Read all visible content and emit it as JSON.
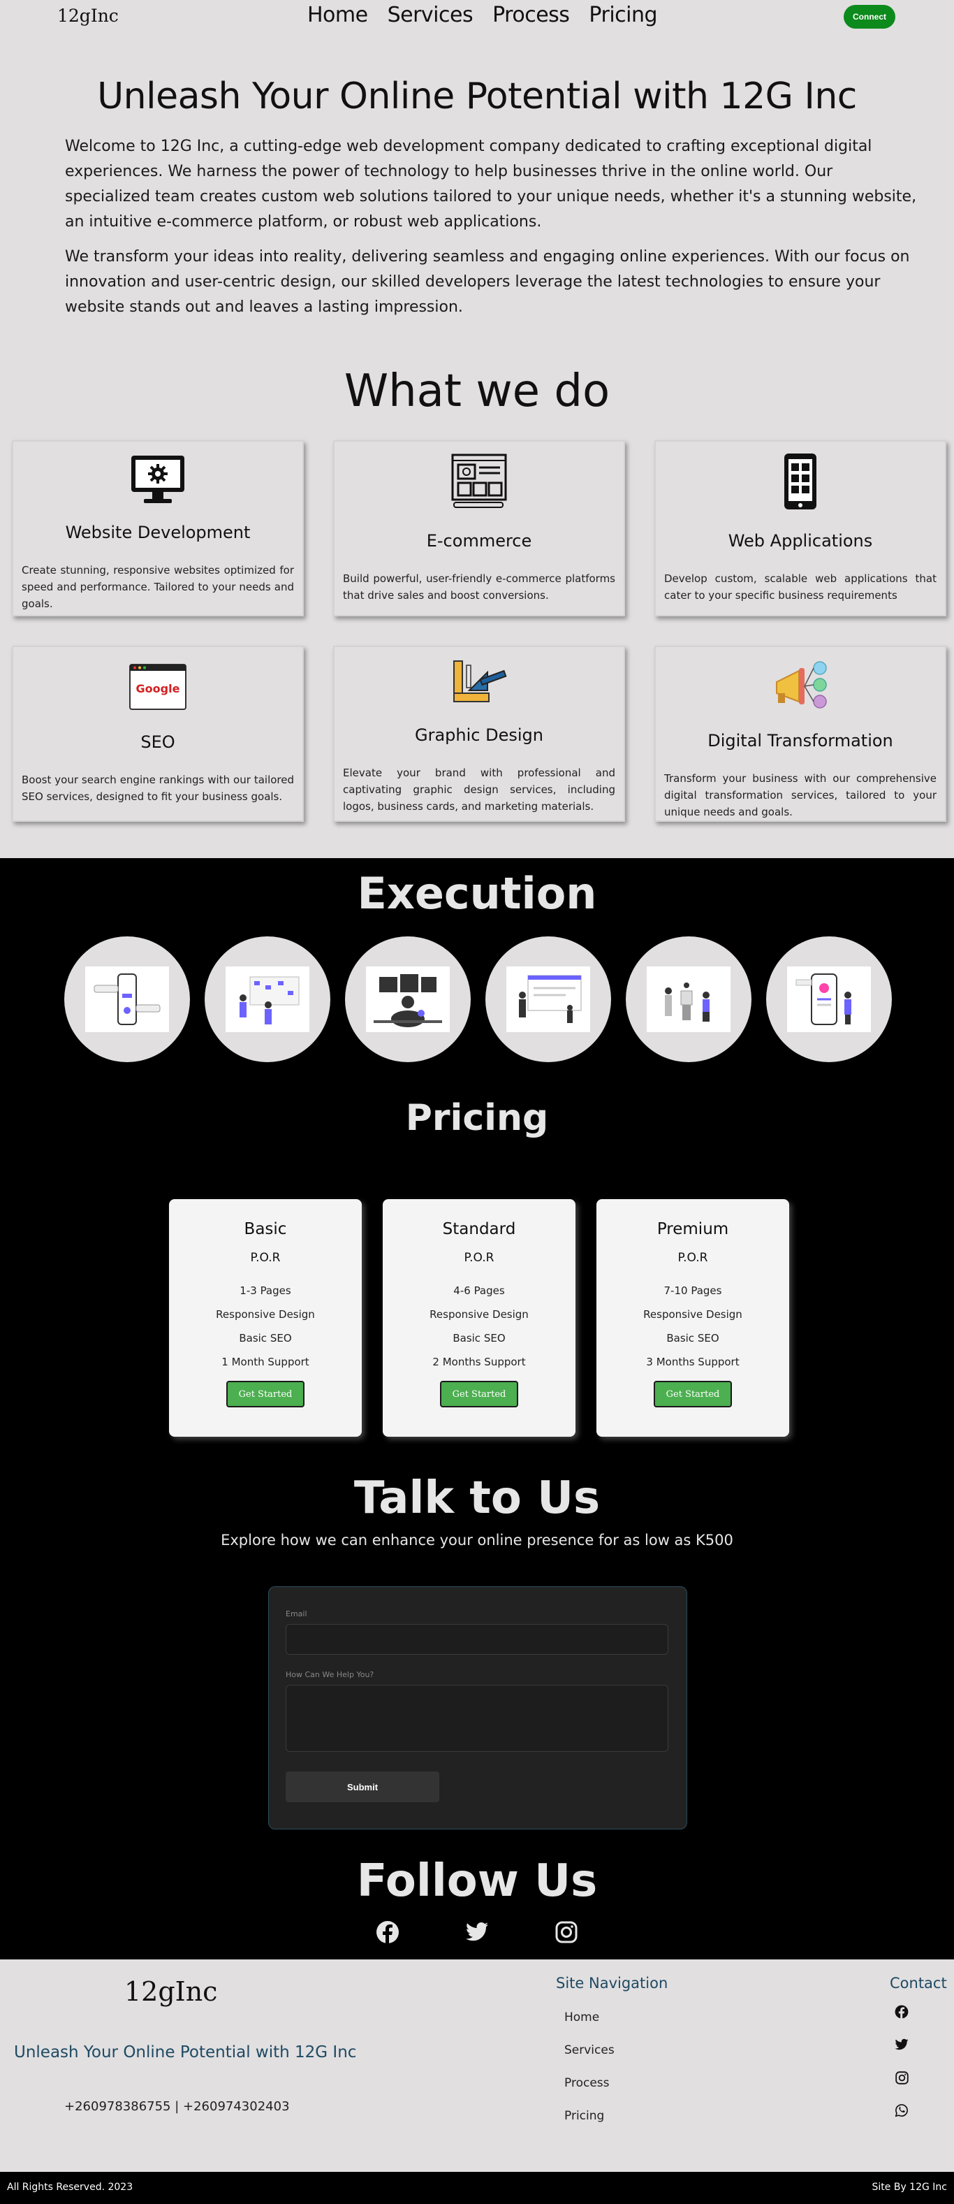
{
  "header": {
    "logo": "12gInc",
    "nav": [
      "Home",
      "Services",
      "Process",
      "Pricing"
    ],
    "connect_label": "Connect"
  },
  "hero": {
    "title": "Unleash Your Online Potential with 12G Inc",
    "paragraphs": [
      "Welcome to 12G Inc, a cutting-edge web development company dedicated to crafting exceptional digital experiences. We harness the power of technology to help businesses thrive in the online world. Our specialized team creates custom web solutions tailored to your unique needs, whether it's a stunning website, an intuitive e-commerce platform, or robust web applications.",
      "We transform your ideas into reality, delivering seamless and engaging online experiences. With our focus on innovation and user-centric design, our skilled developers leverage the latest technologies to ensure your website stands out and leaves a lasting impression."
    ]
  },
  "services": {
    "title": "What we do",
    "items": [
      {
        "icon": "monitor-gear-icon",
        "title": "Website Development",
        "text": "Create stunning, responsive websites optimized for speed and performance. Tailored to your needs and goals."
      },
      {
        "icon": "wireframe-icon",
        "title": "E-commerce",
        "text": "Build powerful, user-friendly e-commerce platforms that drive sales and boost conversions."
      },
      {
        "icon": "mobile-app-icon",
        "title": "Web Applications",
        "text": "Develop custom, scalable web applications that cater to your specific business requirements"
      },
      {
        "icon": "google-search-icon",
        "title": "SEO",
        "text": "Boost your search engine rankings with our tailored SEO services, designed to fit your business goals.",
        "icon_text": "Google"
      },
      {
        "icon": "design-tools-icon",
        "title": "Graphic Design",
        "text": "Elevate your brand with professional and captivating graphic design services, including logos, business cards, and marketing materials."
      },
      {
        "icon": "megaphone-icon",
        "title": "Digital Transformation",
        "text": "Transform your business with our comprehensive digital transformation services, tailored to your unique needs and goals."
      }
    ]
  },
  "execution": {
    "title": "Execution",
    "images": [
      "mobile-chat-illustration",
      "team-board-illustration",
      "developer-desk-illustration",
      "presentation-illustration",
      "collaboration-illustration",
      "mobile-profile-illustration"
    ]
  },
  "pricing": {
    "title": "Pricing",
    "plans": [
      {
        "name": "Basic",
        "price": "P.O.R",
        "features": [
          "1-3 Pages",
          "Responsive Design",
          "Basic SEO",
          "1 Month Support"
        ],
        "cta": "Get Started"
      },
      {
        "name": "Standard",
        "price": "P.O.R",
        "features": [
          "4-6 Pages",
          "Responsive Design",
          "Basic SEO",
          "2 Months Support"
        ],
        "cta": "Get Started"
      },
      {
        "name": "Premium",
        "price": "P.O.R",
        "features": [
          "7-10 Pages",
          "Responsive Design",
          "Basic SEO",
          "3 Months Support"
        ],
        "cta": "Get Started"
      }
    ]
  },
  "contact_form": {
    "title": "Talk to Us",
    "subtitle": "Explore how we can enhance your online presence for as low as K500",
    "email_label": "Email",
    "email_value": "",
    "message_label": "How Can We Help You?",
    "submit_label": "Submit"
  },
  "follow": {
    "title": "Follow Us",
    "icons": [
      "facebook-icon",
      "twitter-icon",
      "instagram-icon"
    ]
  },
  "footer": {
    "logo": "12gInc",
    "tagline": "Unleash Your Online Potential with 12G Inc",
    "phones": "+260978386755 | +260974302403",
    "nav_title": "Site Navigation",
    "nav": [
      "Home",
      "Services",
      "Process",
      "Pricing"
    ],
    "contact_title": "Contact",
    "contact_icons": [
      "facebook-icon",
      "twitter-icon",
      "instagram-icon",
      "whatsapp-icon"
    ],
    "rights": "All Rights Reserved. 2023",
    "credit": "Site By 12G Inc"
  },
  "colors": {
    "accent_green": "#0c8a1b",
    "button_green": "#4caf50",
    "footer_blue": "#1e4a63",
    "light_bg": "#e1dfe0"
  }
}
